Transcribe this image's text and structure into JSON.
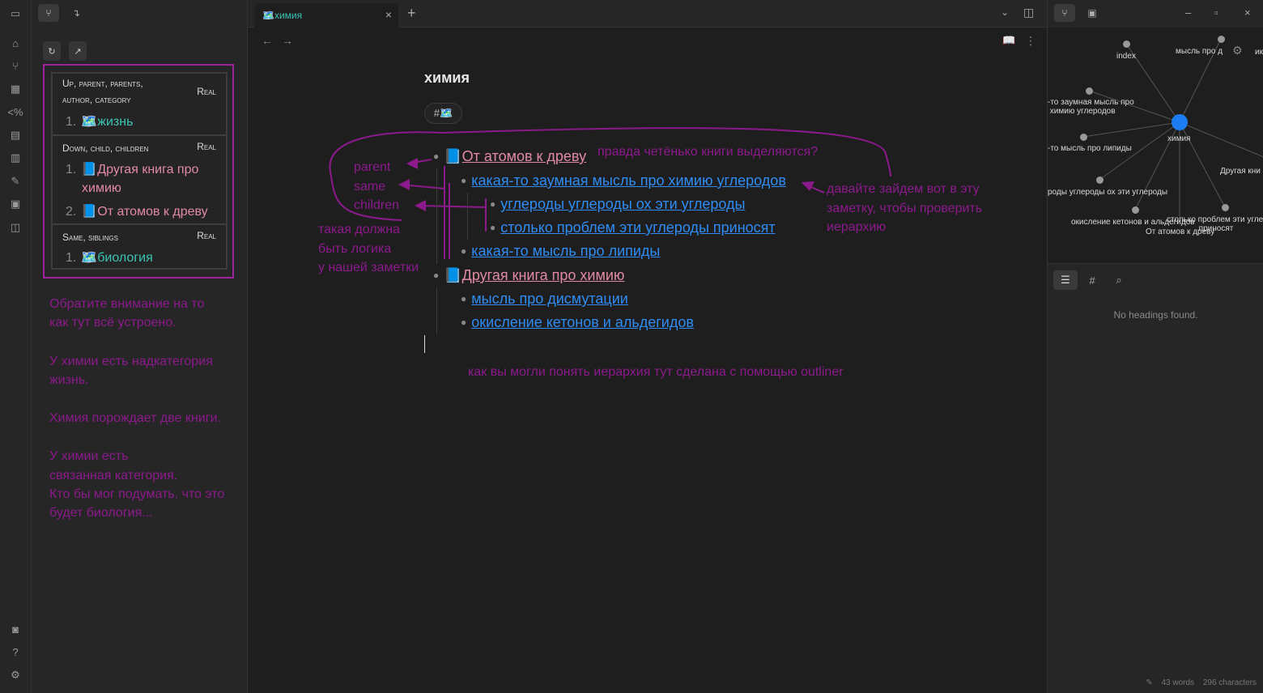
{
  "left_pane": {
    "breadcrumbs": {
      "refresh_label": "↻",
      "open_label": "↗",
      "sections": [
        {
          "header": "Up, parent, parents, author, category",
          "badge": "Real",
          "items": [
            {
              "num": "1.",
              "text": "🗺️жизнь"
            }
          ]
        },
        {
          "header": "Down, child, children",
          "badge": "Real",
          "items": [
            {
              "num": "1.",
              "text": "📘Другая книга про химию"
            },
            {
              "num": "2.",
              "text": "📘От атомов к древу"
            }
          ]
        },
        {
          "header": "Same, siblings",
          "badge": "Real",
          "items": [
            {
              "num": "1.",
              "text": "🗺️биология"
            }
          ]
        }
      ]
    },
    "note_lines": [
      "Обратите внимание на то",
      "как тут всё устроено.",
      "",
      "У химии есть надкатегория",
      "жизнь.",
      "",
      "Химия порождает две книги.",
      "",
      "У химии есть",
      "связанная категория.",
      "Кто бы мог подумать, что это",
      "будет биология..."
    ]
  },
  "center": {
    "tab_title": "🗺️химия",
    "tab_close": "×",
    "new_tab": "+",
    "note_title": "химия",
    "tag": "#🗺️",
    "outline": [
      {
        "level": 0,
        "icon": "📘",
        "text": "От атомов к древу",
        "style": "pink"
      },
      {
        "level": 1,
        "text": "какая-то заумная мысль про химию углеродов",
        "style": "link"
      },
      {
        "level": 2,
        "text": "углероды углероды ох эти углероды",
        "style": "link"
      },
      {
        "level": 2,
        "text": "столько проблем эти углероды приносят",
        "style": "link"
      },
      {
        "level": 1,
        "text": "какая-то мысль про липиды",
        "style": "link"
      },
      {
        "level": 0,
        "icon": "📘",
        "text": "Другая книга про химию",
        "style": "pink"
      },
      {
        "level": 1,
        "text": "мысль про дисмутации",
        "style": "link"
      },
      {
        "level": 1,
        "text": "окисление кетонов и альдегидов",
        "style": "link"
      }
    ],
    "annotations": {
      "books_question": "правда четёнько книги выделяются?",
      "parent": "parent",
      "same": "same",
      "children": "children",
      "logic": "такая должна\nбыть логика\nу нашей заметки",
      "enter": "давайте зайдем вот в эту\nзаметку, чтобы проверить\nиерархию",
      "outliner": "как вы могли понять иерархия тут сделана с помощью outliner"
    }
  },
  "right_pane": {
    "graph_nodes": [
      {
        "label": "index"
      },
      {
        "label": "мысль про д"
      },
      {
        "label": "ик"
      },
      {
        "label": "-то заумная мысль про\n химию углеродов"
      },
      {
        "label": "химия"
      },
      {
        "label": "-то мысль про липиды"
      },
      {
        "label": "Другая кни"
      },
      {
        "label": "роды углероды ох эти углероды"
      },
      {
        "label": "окисление кетонов и альдегидов"
      },
      {
        "label": "столько проблем эти угле\n приносят"
      },
      {
        "label": "От атомов к древу"
      }
    ],
    "no_headings": "No headings found.",
    "status": {
      "words": "43 words",
      "characters": "296 characters"
    }
  },
  "colors": {
    "accent_blue": "#2f8cf3",
    "teal": "#3cc5b5",
    "pink": "#e28aa3",
    "annotation": "#8c1a8c",
    "highlight_box": "#a020a0"
  }
}
